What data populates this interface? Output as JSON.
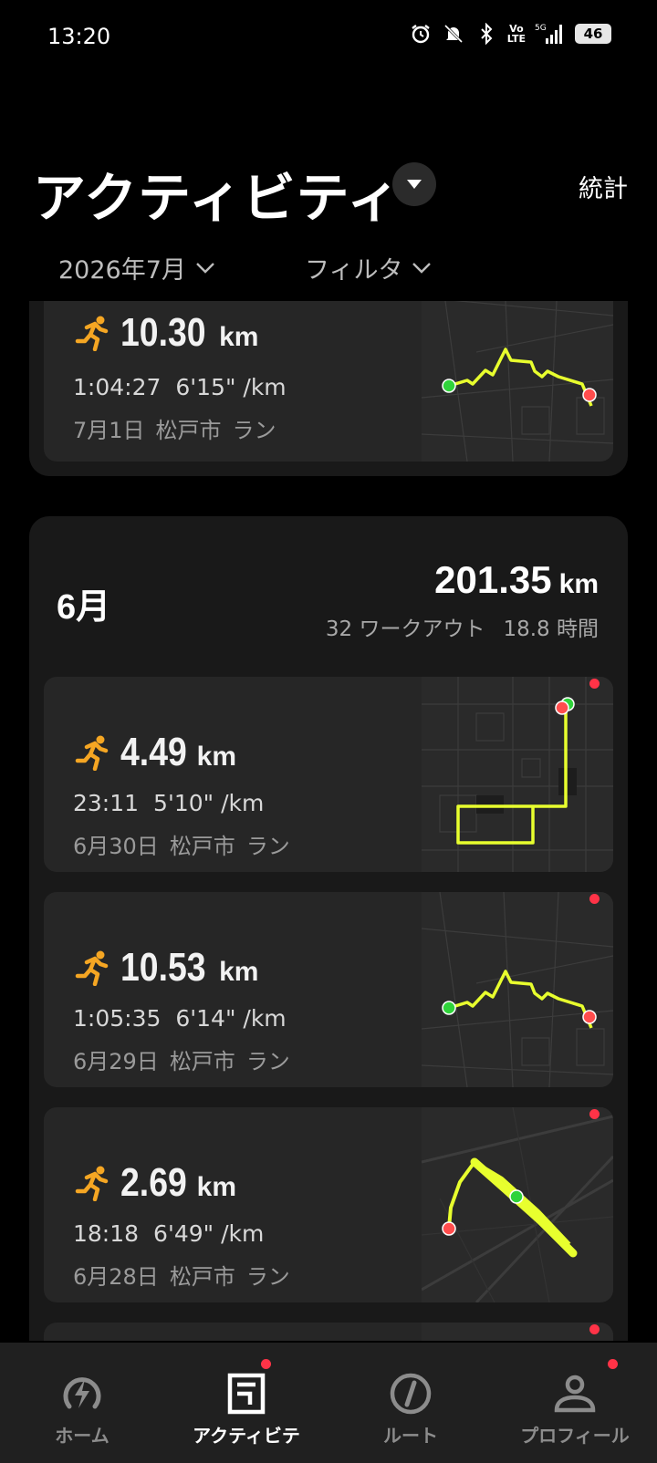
{
  "status_bar": {
    "time": "13:20",
    "network": "5G",
    "volte": "Vo",
    "lte": "LTE",
    "battery": "46"
  },
  "header": {
    "title": "アクティビティ",
    "stats_label": "統計"
  },
  "filters": {
    "month": "2026年7月",
    "filter": "フィルタ"
  },
  "july_activity": {
    "distance": "10.30",
    "unit": "km",
    "duration": "1:04:27",
    "pace": "6'15\" /km",
    "date": "7月1日",
    "place": "松戸市",
    "type": "ラン"
  },
  "june": {
    "month_label": "6月",
    "total_distance": "201.35",
    "unit": "km",
    "workouts": "32 ワークアウト",
    "hours": "18.8 時間",
    "activities": [
      {
        "distance": "4.49",
        "unit": "km",
        "duration": "23:11",
        "pace": "5'10\" /km",
        "date": "6月30日",
        "place": "松戸市",
        "type": "ラン"
      },
      {
        "distance": "10.53",
        "unit": "km",
        "duration": "1:05:35",
        "pace": "6'14\" /km",
        "date": "6月29日",
        "place": "松戸市",
        "type": "ラン"
      },
      {
        "distance": "2.69",
        "unit": "km",
        "duration": "18:18",
        "pace": "6'49\" /km",
        "date": "6月28日",
        "place": "松戸市",
        "type": "ラン"
      }
    ]
  },
  "nav": {
    "items": [
      {
        "label": "ホーム",
        "icon": "bolt-icon"
      },
      {
        "label": "アクティビテ",
        "icon": "activity-icon"
      },
      {
        "label": "ルート",
        "icon": "compass-icon"
      },
      {
        "label": "プロフィール",
        "icon": "person-icon"
      }
    ]
  },
  "colors": {
    "accent_orange": "#f5a623",
    "route_yellow": "#e8ff2e",
    "start_green": "#2fd33a",
    "end_red": "#ff4d4d"
  }
}
